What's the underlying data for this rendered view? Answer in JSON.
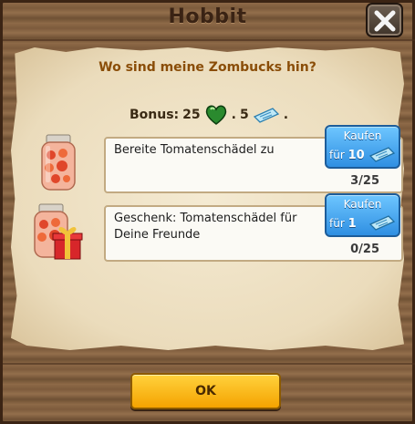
{
  "dialog": {
    "title": "Hobbit",
    "question": "Wo sind meine Zombucks hin?",
    "close_icon": "close-x-icon"
  },
  "bonus": {
    "label": "Bonus:",
    "hearts": "25",
    "sep1": ".",
    "zombucks": "5",
    "sep2": ".",
    "heart_icon": "green-heart-icon",
    "zombuck_icon": "zombuck-ticket-icon"
  },
  "tasks": [
    {
      "text": "Bereite Tomatenschädel zu",
      "progress": "3/25",
      "buy_label": "Kaufen",
      "buy_prefix": "für",
      "buy_amount": "10",
      "icon": "tomato-skull-jar-icon"
    },
    {
      "text": "Geschenk: Tomatenschädel für Deine Freunde",
      "progress": "0/25",
      "buy_label": "Kaufen",
      "buy_prefix": "für",
      "buy_amount": "1",
      "icon": "tomato-skull-jar-gift-icon"
    }
  ],
  "footer": {
    "ok_label": "OK"
  },
  "colors": {
    "accent": "#f5a300",
    "buy": "#2f8fe2",
    "question": "#8a4d08"
  }
}
